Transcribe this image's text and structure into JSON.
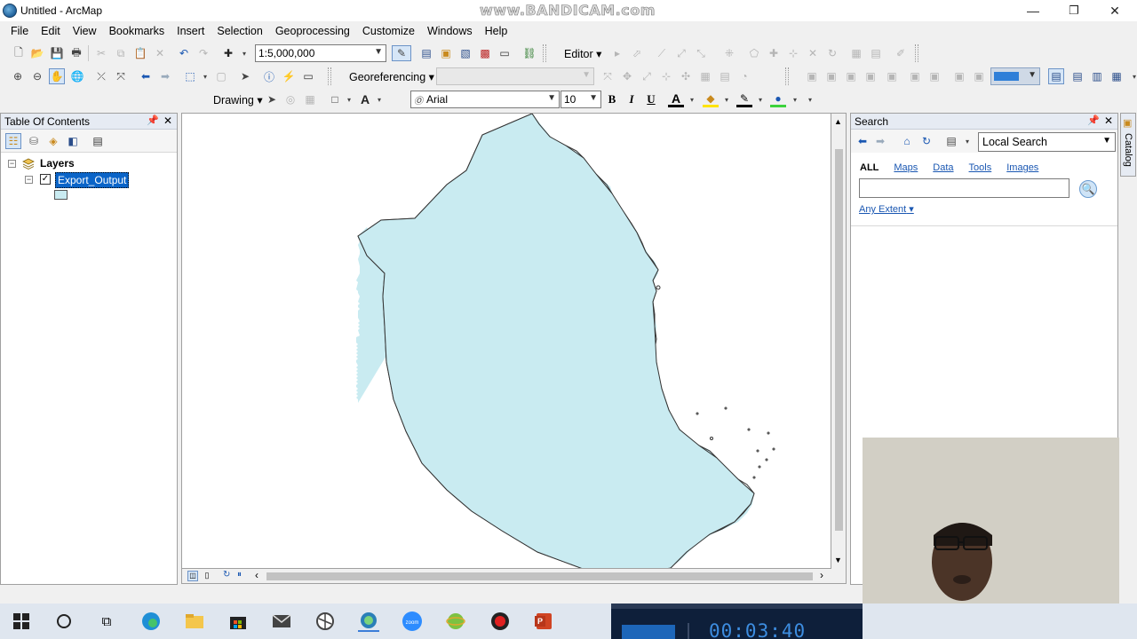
{
  "window": {
    "title": "Untitled - ArcMap",
    "watermark": "www.BANDICAM.com",
    "minimize": "—",
    "restore": "❐",
    "close": "✕"
  },
  "menu": [
    "File",
    "Edit",
    "View",
    "Bookmarks",
    "Insert",
    "Selection",
    "Geoprocessing",
    "Customize",
    "Windows",
    "Help"
  ],
  "standard_toolbar": {
    "scale": "1:5,000,000",
    "editor_label": "Editor"
  },
  "tools_toolbar": {
    "georeferencing_label": "Georeferencing"
  },
  "draw_toolbar": {
    "drawing_label": "Drawing",
    "font_name": "Arial",
    "font_size": "10",
    "bold": "B",
    "italic": "I",
    "underline": "U",
    "font_color_glyph": "A"
  },
  "toc": {
    "title": "Table Of Contents",
    "root_label": "Layers",
    "layer_name": "Export_Output",
    "layer_checked": true,
    "fill_color": "#c9ebf1"
  },
  "map": {
    "fill_color": "#c9ebf1",
    "outline_color": "#333333"
  },
  "search": {
    "title": "Search",
    "scope": "Local Search",
    "tabs": [
      "ALL",
      "Maps",
      "Data",
      "Tools",
      "Images"
    ],
    "active_tab": "ALL",
    "query": "",
    "extent_label": "Any Extent"
  },
  "catalog_tab": "Catalog",
  "bandicam": {
    "timer": "00:03:40"
  },
  "taskbar": {
    "icons": [
      "windows-start",
      "search",
      "task-view",
      "edge",
      "file-explorer",
      "store",
      "mail",
      "chrome-like",
      "arcmap",
      "zoom",
      "globe-app",
      "record",
      "powerpoint"
    ]
  }
}
